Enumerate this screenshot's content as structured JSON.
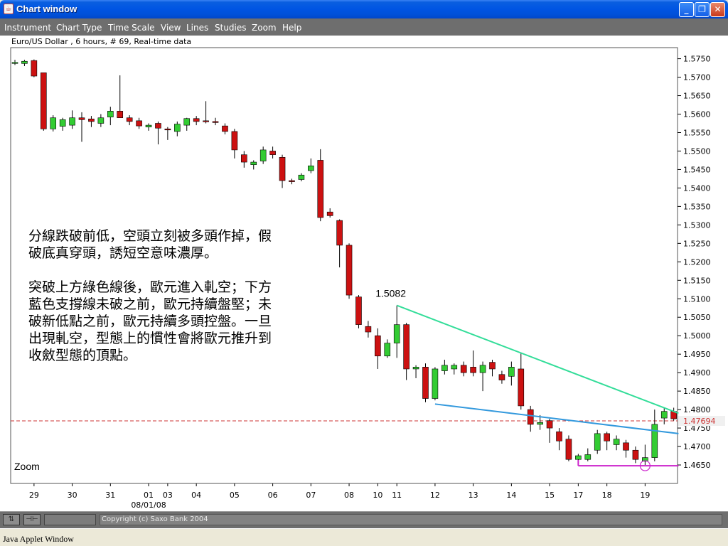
{
  "window": {
    "title": "Chart window",
    "status": "Java Applet Window",
    "minimize_glyph": "_",
    "maximize_glyph": "❐",
    "close_glyph": "✕",
    "icon": "java-cup-icon"
  },
  "menu": [
    "Instrument",
    "Chart Type",
    "Time Scale",
    "View",
    "Lines",
    "Studies",
    "Zoom",
    "Help"
  ],
  "bottom": {
    "copyright": "Copyright (c) Saxo Bank 2004",
    "pan_icon": "⇅",
    "move_icon": "⊣⊢"
  },
  "chart_data": {
    "type": "candlestick",
    "title": "Euro/US Dollar , 6 hours, # 69, Real-time data",
    "zoom_label": "Zoom",
    "ylim": [
      1.46,
      1.578
    ],
    "yticks": [
      "1.5750",
      "1.5700",
      "1.5650",
      "1.5600",
      "1.5550",
      "1.5500",
      "1.5450",
      "1.5400",
      "1.5350",
      "1.5300",
      "1.5250",
      "1.5200",
      "1.5150",
      "1.5100",
      "1.5050",
      "1.5000",
      "1.4950",
      "1.4900",
      "1.4850",
      "1.4800",
      "1.4750",
      "1.4700",
      "1.4650"
    ],
    "xticks": [
      "29",
      "30",
      "31",
      "01",
      "03",
      "04",
      "05",
      "06",
      "07",
      "08",
      "10",
      "11",
      "12",
      "13",
      "14",
      "15",
      "17",
      "18",
      "19"
    ],
    "date_label": "08/01/08",
    "current_price": "1.47694",
    "current_value": 1.47694,
    "high_label": "1.5082",
    "colors": {
      "up": "#33cc33",
      "down": "#cc1111",
      "resistance": "#33dd99",
      "support": "#3399dd",
      "low_line": "#cc22cc",
      "price_line": "#cc3333",
      "axis_label_bg": "#f0f0f0"
    },
    "candles": [
      {
        "o": 1.574,
        "h": 1.5747,
        "l": 1.5733,
        "c": 1.574
      },
      {
        "o": 1.5737,
        "h": 1.5747,
        "l": 1.573,
        "c": 1.5743
      },
      {
        "o": 1.5745,
        "h": 1.5748,
        "l": 1.57,
        "c": 1.5703
      },
      {
        "o": 1.5712,
        "h": 1.5712,
        "l": 1.5555,
        "c": 1.556
      },
      {
        "o": 1.556,
        "h": 1.5597,
        "l": 1.5553,
        "c": 1.559
      },
      {
        "o": 1.5567,
        "h": 1.559,
        "l": 1.5555,
        "c": 1.5585
      },
      {
        "o": 1.557,
        "h": 1.561,
        "l": 1.556,
        "c": 1.559
      },
      {
        "o": 1.559,
        "h": 1.5605,
        "l": 1.5525,
        "c": 1.5585
      },
      {
        "o": 1.5587,
        "h": 1.5595,
        "l": 1.5565,
        "c": 1.558
      },
      {
        "o": 1.5575,
        "h": 1.56,
        "l": 1.5565,
        "c": 1.559
      },
      {
        "o": 1.5592,
        "h": 1.562,
        "l": 1.557,
        "c": 1.5608
      },
      {
        "o": 1.5608,
        "h": 1.5705,
        "l": 1.559,
        "c": 1.559
      },
      {
        "o": 1.559,
        "h": 1.5597,
        "l": 1.557,
        "c": 1.558
      },
      {
        "o": 1.5582,
        "h": 1.559,
        "l": 1.556,
        "c": 1.5568
      },
      {
        "o": 1.5565,
        "h": 1.5575,
        "l": 1.5555,
        "c": 1.557
      },
      {
        "o": 1.5575,
        "h": 1.558,
        "l": 1.5518,
        "c": 1.5562
      },
      {
        "o": 1.556,
        "h": 1.5565,
        "l": 1.553,
        "c": 1.5558
      },
      {
        "o": 1.5553,
        "h": 1.558,
        "l": 1.554,
        "c": 1.5573
      },
      {
        "o": 1.557,
        "h": 1.559,
        "l": 1.5555,
        "c": 1.5588
      },
      {
        "o": 1.5588,
        "h": 1.5595,
        "l": 1.557,
        "c": 1.558
      },
      {
        "o": 1.5582,
        "h": 1.5635,
        "l": 1.5575,
        "c": 1.558
      },
      {
        "o": 1.558,
        "h": 1.559,
        "l": 1.557,
        "c": 1.5578
      },
      {
        "o": 1.5568,
        "h": 1.5575,
        "l": 1.5545,
        "c": 1.5553
      },
      {
        "o": 1.5553,
        "h": 1.556,
        "l": 1.548,
        "c": 1.5503
      },
      {
        "o": 1.549,
        "h": 1.55,
        "l": 1.5455,
        "c": 1.547
      },
      {
        "o": 1.5463,
        "h": 1.5475,
        "l": 1.545,
        "c": 1.547
      },
      {
        "o": 1.5473,
        "h": 1.5512,
        "l": 1.5465,
        "c": 1.5503
      },
      {
        "o": 1.55,
        "h": 1.5512,
        "l": 1.548,
        "c": 1.549
      },
      {
        "o": 1.5483,
        "h": 1.549,
        "l": 1.54,
        "c": 1.542
      },
      {
        "o": 1.542,
        "h": 1.5425,
        "l": 1.541,
        "c": 1.5417
      },
      {
        "o": 1.5423,
        "h": 1.544,
        "l": 1.5418,
        "c": 1.5435
      },
      {
        "o": 1.5447,
        "h": 1.548,
        "l": 1.544,
        "c": 1.546
      },
      {
        "o": 1.5475,
        "h": 1.5505,
        "l": 1.531,
        "c": 1.532
      },
      {
        "o": 1.5335,
        "h": 1.5345,
        "l": 1.532,
        "c": 1.5325
      },
      {
        "o": 1.5312,
        "h": 1.5315,
        "l": 1.5185,
        "c": 1.5245
      },
      {
        "o": 1.5245,
        "h": 1.525,
        "l": 1.51,
        "c": 1.511
      },
      {
        "o": 1.5105,
        "h": 1.511,
        "l": 1.502,
        "c": 1.503
      },
      {
        "o": 1.5025,
        "h": 1.504,
        "l": 1.4995,
        "c": 1.501
      },
      {
        "o": 1.5,
        "h": 1.502,
        "l": 1.491,
        "c": 1.4945
      },
      {
        "o": 1.4945,
        "h": 1.499,
        "l": 1.494,
        "c": 1.498
      },
      {
        "o": 1.498,
        "h": 1.5082,
        "l": 1.494,
        "c": 1.503
      },
      {
        "o": 1.503,
        "h": 1.5035,
        "l": 1.488,
        "c": 1.491
      },
      {
        "o": 1.491,
        "h": 1.492,
        "l": 1.4885,
        "c": 1.4915
      },
      {
        "o": 1.4915,
        "h": 1.4925,
        "l": 1.482,
        "c": 1.483
      },
      {
        "o": 1.483,
        "h": 1.4915,
        "l": 1.4825,
        "c": 1.491
      },
      {
        "o": 1.4905,
        "h": 1.4935,
        "l": 1.4895,
        "c": 1.492
      },
      {
        "o": 1.491,
        "h": 1.4925,
        "l": 1.4895,
        "c": 1.492
      },
      {
        "o": 1.492,
        "h": 1.493,
        "l": 1.489,
        "c": 1.49
      },
      {
        "o": 1.4915,
        "h": 1.496,
        "l": 1.489,
        "c": 1.49
      },
      {
        "o": 1.49,
        "h": 1.493,
        "l": 1.485,
        "c": 1.492
      },
      {
        "o": 1.4928,
        "h": 1.4935,
        "l": 1.489,
        "c": 1.491
      },
      {
        "o": 1.4895,
        "h": 1.4905,
        "l": 1.487,
        "c": 1.488
      },
      {
        "o": 1.489,
        "h": 1.493,
        "l": 1.4865,
        "c": 1.4915
      },
      {
        "o": 1.491,
        "h": 1.4952,
        "l": 1.48,
        "c": 1.481
      },
      {
        "o": 1.48,
        "h": 1.481,
        "l": 1.474,
        "c": 1.476
      },
      {
        "o": 1.476,
        "h": 1.4785,
        "l": 1.4745,
        "c": 1.4765
      },
      {
        "o": 1.477,
        "h": 1.4775,
        "l": 1.471,
        "c": 1.475
      },
      {
        "o": 1.474,
        "h": 1.475,
        "l": 1.469,
        "c": 1.4715
      },
      {
        "o": 1.472,
        "h": 1.473,
        "l": 1.466,
        "c": 1.4665
      },
      {
        "o": 1.4665,
        "h": 1.468,
        "l": 1.4655,
        "c": 1.4675
      },
      {
        "o": 1.4665,
        "h": 1.4695,
        "l": 1.466,
        "c": 1.4678
      },
      {
        "o": 1.469,
        "h": 1.4745,
        "l": 1.468,
        "c": 1.4735
      },
      {
        "o": 1.4735,
        "h": 1.474,
        "l": 1.469,
        "c": 1.4715
      },
      {
        "o": 1.4705,
        "h": 1.473,
        "l": 1.469,
        "c": 1.472
      },
      {
        "o": 1.471,
        "h": 1.4718,
        "l": 1.467,
        "c": 1.469
      },
      {
        "o": 1.469,
        "h": 1.47,
        "l": 1.4655,
        "c": 1.4665
      },
      {
        "o": 1.466,
        "h": 1.4705,
        "l": 1.465,
        "c": 1.467
      },
      {
        "o": 1.467,
        "h": 1.48,
        "l": 1.466,
        "c": 1.476
      },
      {
        "o": 1.4777,
        "h": 1.4805,
        "l": 1.476,
        "c": 1.4795
      },
      {
        "o": 1.4795,
        "h": 1.4805,
        "l": 1.477,
        "c": 1.4775
      }
    ],
    "lines": {
      "resistance": {
        "from": {
          "i": 40,
          "v": 1.5082
        },
        "to": {
          "i": 69.5,
          "v": 1.479
        }
      },
      "support": {
        "from": {
          "i": 44,
          "v": 1.4815
        },
        "to": {
          "i": 69.5,
          "v": 1.4735
        }
      },
      "low": {
        "from": {
          "i": 59,
          "v": 1.4648
        },
        "to": {
          "i": 69.5,
          "v": 1.4648
        }
      }
    },
    "annotation": [
      "分線跌破前低，空頭立刻被多頭作掉，假",
      "破底真穿頭，誘短空意味濃厚。",
      "",
      "突破上方綠色線後，歐元進入軋空；下方",
      "藍色支撐線未破之前，歐元持續盤堅；未",
      "破新低點之前，歐元持續多頭控盤。一旦",
      "出現軋空，型態上的慣性會將歐元推升到",
      "收斂型態的頂點。"
    ]
  }
}
